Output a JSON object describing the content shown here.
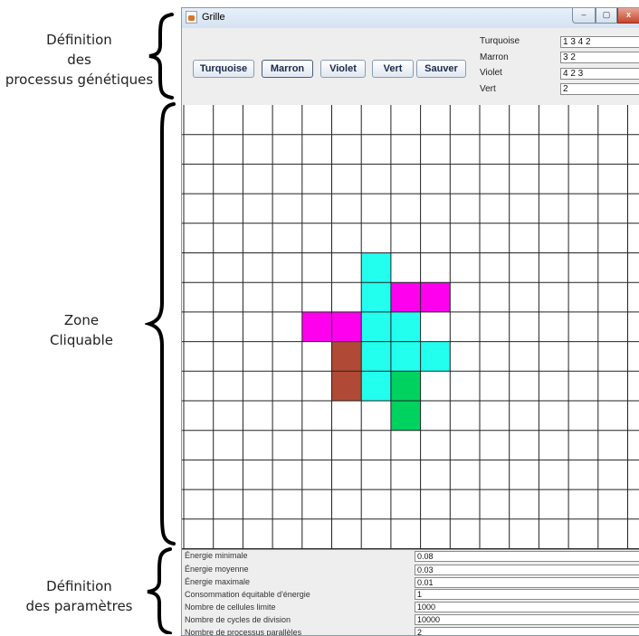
{
  "annotations": {
    "genetic": [
      "Définition",
      "des",
      "processus génétiques"
    ],
    "zone": [
      "Zone",
      "Cliquable"
    ],
    "params": [
      "Définition",
      "des paramètres"
    ]
  },
  "window": {
    "title": "Grille",
    "minimize": "–",
    "maximize": "▢",
    "close": "x"
  },
  "toolbar": {
    "buttons": [
      {
        "label": "Turquoise",
        "name": "turquoise-button"
      },
      {
        "label": "Marron",
        "name": "marron-button"
      },
      {
        "label": "Violet",
        "name": "violet-button"
      },
      {
        "label": "Vert",
        "name": "vert-button"
      },
      {
        "label": "Sauver",
        "name": "sauver-button"
      }
    ],
    "genes": [
      {
        "label": "Turquoise",
        "value": "1 3 4 2"
      },
      {
        "label": "Marron",
        "value": "3 2"
      },
      {
        "label": "Violet",
        "value": "4 2 3"
      },
      {
        "label": "Vert",
        "value": "2"
      }
    ]
  },
  "grid": {
    "columns": 16,
    "rows": 15,
    "colors": {
      "turquoise": "#22ffee",
      "violet": "#ff00ee",
      "marron": "#b04a36",
      "vert": "#00d260"
    },
    "filled_cells": [
      {
        "row": 5,
        "col": 6,
        "color": "turquoise"
      },
      {
        "row": 6,
        "col": 6,
        "color": "turquoise"
      },
      {
        "row": 6,
        "col": 7,
        "color": "violet"
      },
      {
        "row": 6,
        "col": 8,
        "color": "violet"
      },
      {
        "row": 7,
        "col": 4,
        "color": "violet"
      },
      {
        "row": 7,
        "col": 5,
        "color": "violet"
      },
      {
        "row": 7,
        "col": 6,
        "color": "turquoise"
      },
      {
        "row": 7,
        "col": 7,
        "color": "turquoise"
      },
      {
        "row": 8,
        "col": 5,
        "color": "marron"
      },
      {
        "row": 8,
        "col": 6,
        "color": "turquoise"
      },
      {
        "row": 8,
        "col": 7,
        "color": "turquoise"
      },
      {
        "row": 8,
        "col": 8,
        "color": "turquoise"
      },
      {
        "row": 9,
        "col": 5,
        "color": "marron"
      },
      {
        "row": 9,
        "col": 6,
        "color": "turquoise"
      },
      {
        "row": 9,
        "col": 7,
        "color": "vert"
      },
      {
        "row": 10,
        "col": 7,
        "color": "vert"
      }
    ]
  },
  "params": [
    {
      "label": "Énergie minimale",
      "value": "0.08"
    },
    {
      "label": "Énergie moyenne",
      "value": "0.03"
    },
    {
      "label": "Énergie maximale",
      "value": "0.01"
    },
    {
      "label": "Consommation équitable d'énergie",
      "value": "1"
    },
    {
      "label": "Nombre de cellules limite",
      "value": "1000"
    },
    {
      "label": "Nombre de cycles de division",
      "value": "10000"
    },
    {
      "label": "Nombre de processus parallèles",
      "value": "2"
    }
  ]
}
